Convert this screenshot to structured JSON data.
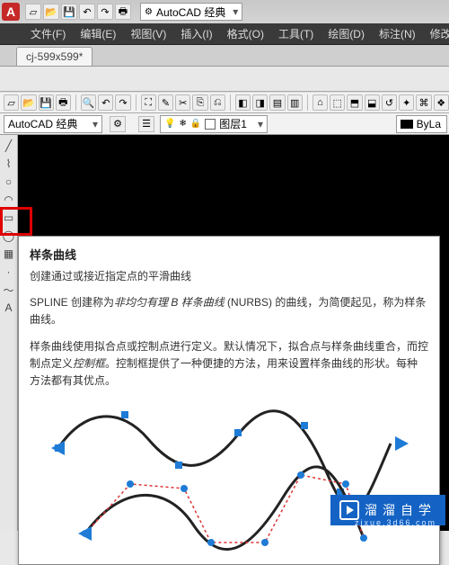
{
  "app": {
    "logo_letter": "A",
    "workspace_label": "AutoCAD 经典"
  },
  "menubar": {
    "file": "文件(F)",
    "edit": "编辑(E)",
    "view": "视图(V)",
    "insert": "插入(I)",
    "format": "格式(O)",
    "tools": "工具(T)",
    "draw": "绘图(D)",
    "annotate": "标注(N)",
    "modify": "修改"
  },
  "tabs": {
    "active": "cj-599x599*"
  },
  "workspace_dd": "AutoCAD 经典",
  "layer": {
    "name": "图层1"
  },
  "bylayer": "ByLa",
  "tooltip": {
    "title": "样条曲线",
    "summary": "创建通过或接近指定点的平滑曲线",
    "para1_pre": "SPLINE 创建称为",
    "para1_em": "非均匀有理 B 样条曲线",
    "para1_post": " (NURBS) 的曲线，为简便起见，称为样条曲线。",
    "para2_pre": "样条曲线使用拟合点或控制点进行定义。默认情况下，拟合点与样条曲线重合，而控制点定义",
    "para2_em": "控制框",
    "para2_post": "。控制框提供了一种便捷的方法，用来设置样条曲线的形状。每种方法都有其优点。"
  },
  "watermark": {
    "brand": "溜溜自学",
    "sub": "zixue.3d66.com"
  },
  "icons": {
    "new": "▱",
    "open": "📂",
    "save": "💾",
    "undo": "↶",
    "redo": "↷",
    "print": "🖶",
    "search": "🔍",
    "gear": "⚙",
    "dropdown": "▾",
    "line": "╱",
    "pline": "⌇",
    "circle": "○",
    "arc": "◠",
    "rect": "▭",
    "ellipse": "◯",
    "hatch": "▦",
    "point": "·",
    "spline": "～",
    "text": "A",
    "bulb": "💡",
    "freeze": "❄",
    "lock": "🔒"
  }
}
